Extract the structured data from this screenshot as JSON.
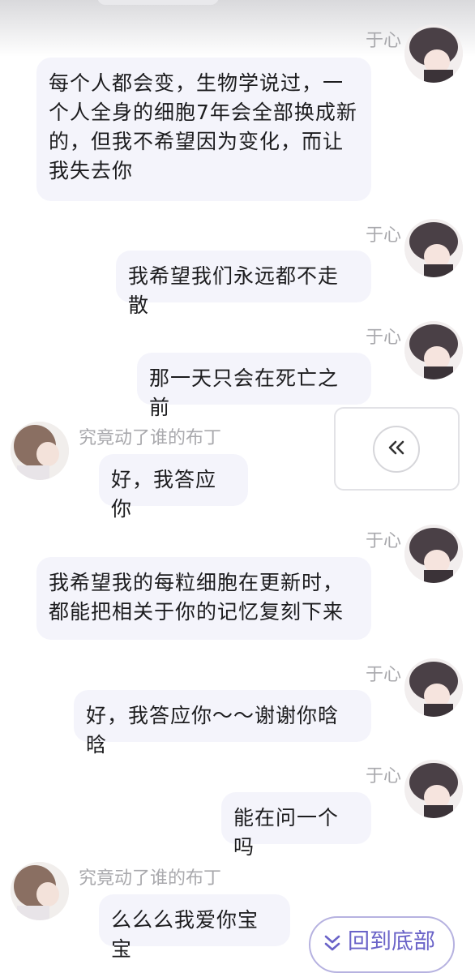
{
  "messages": [
    {
      "side": "right",
      "name": "于心",
      "text": "每个人都会变，生物学说过，一\n个人全身的细胞7年会全部换成新\n的，但我不希望因为变化，而让\n我失去你"
    },
    {
      "side": "right",
      "name": "于心",
      "text": "我希望我们永远都不走散"
    },
    {
      "side": "right",
      "name": "于心",
      "text": "那一天只会在死亡之前"
    },
    {
      "side": "left",
      "name": "究竟动了谁的布丁",
      "text": "好，我答应你"
    },
    {
      "side": "right",
      "name": "于心",
      "text": "我希望我的每粒细胞在更新时，\n都能把相关于你的记忆复刻下来"
    },
    {
      "side": "right",
      "name": "于心",
      "text": "好，我答应你～～谢谢你晗晗"
    },
    {
      "side": "right",
      "name": "于心",
      "text": "能在问一个吗"
    },
    {
      "side": "left",
      "name": "究竟动了谁的布丁",
      "text": "么么么我爱你宝宝"
    }
  ],
  "controls": {
    "collapse_icon": "double-chevron-left-icon",
    "back_to_bottom_icon": "double-chevron-down-icon",
    "back_to_bottom_label": "回到底部"
  },
  "colors": {
    "bubble": "#f4f4fb",
    "name": "#a9a9ad",
    "accent": "#6a63c8"
  }
}
